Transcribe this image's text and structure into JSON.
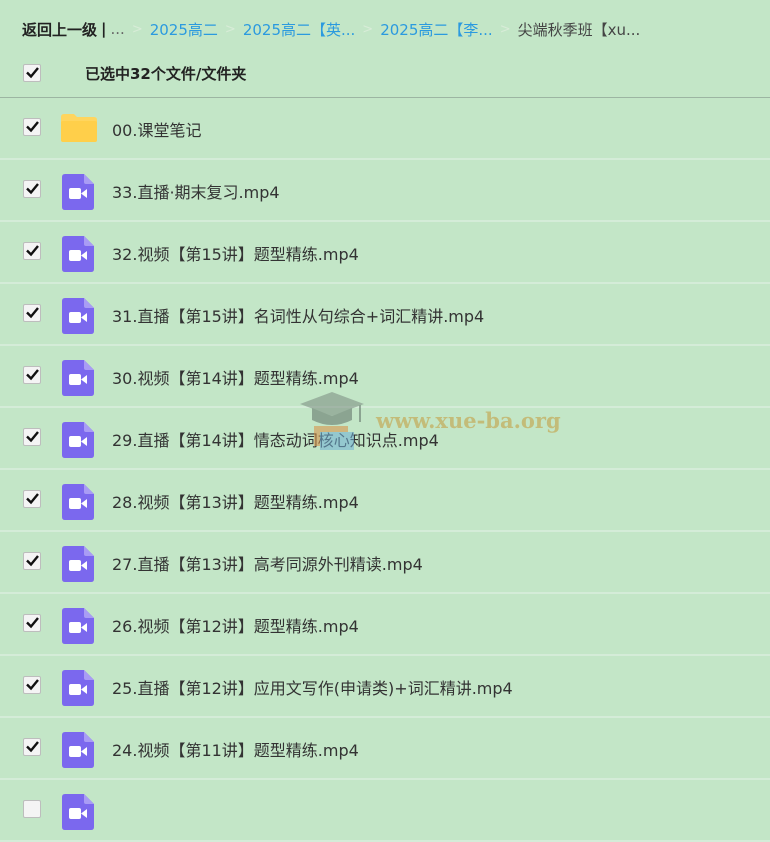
{
  "breadcrumb": {
    "back": "返回上一级",
    "sep": "|",
    "ellipsis": "...",
    "items": [
      "2025高二",
      "2025高二【英...",
      "2025高二【李..."
    ],
    "current": "尖端秋季班【xu..."
  },
  "header": {
    "selected_text": "已选中32个文件/文件夹",
    "checked": true
  },
  "files": [
    {
      "name": "00.课堂笔记",
      "type": "folder",
      "checked": true
    },
    {
      "name": "33.直播·期末复习.mp4",
      "type": "video",
      "checked": true
    },
    {
      "name": "32.视频【第15讲】题型精练.mp4",
      "type": "video",
      "checked": true
    },
    {
      "name": "31.直播【第15讲】名词性从句综合+词汇精讲.mp4",
      "type": "video",
      "checked": true
    },
    {
      "name": "30.视频【第14讲】题型精练.mp4",
      "type": "video",
      "checked": true
    },
    {
      "name": "29.直播【第14讲】情态动词核心知识点.mp4",
      "type": "video",
      "checked": true
    },
    {
      "name": "28.视频【第13讲】题型精练.mp4",
      "type": "video",
      "checked": true
    },
    {
      "name": "27.直播【第13讲】高考同源外刊精读.mp4",
      "type": "video",
      "checked": true
    },
    {
      "name": "26.视频【第12讲】题型精练.mp4",
      "type": "video",
      "checked": true
    },
    {
      "name": "25.直播【第12讲】应用文写作(申请类)+词汇精讲.mp4",
      "type": "video",
      "checked": true
    },
    {
      "name": "24.视频【第11讲】题型精练.mp4",
      "type": "video",
      "checked": true
    },
    {
      "name": "",
      "type": "video",
      "checked": false
    }
  ],
  "watermark": {
    "text": "www.xue-ba.org"
  },
  "colors": {
    "background": "#c3e6c7",
    "link": "#2b9adf",
    "video_icon": "#7b68ee",
    "folder_icon": "#ffd55e"
  },
  "icons": {
    "check": "check-icon",
    "folder": "folder-icon",
    "video": "video-file-icon"
  }
}
